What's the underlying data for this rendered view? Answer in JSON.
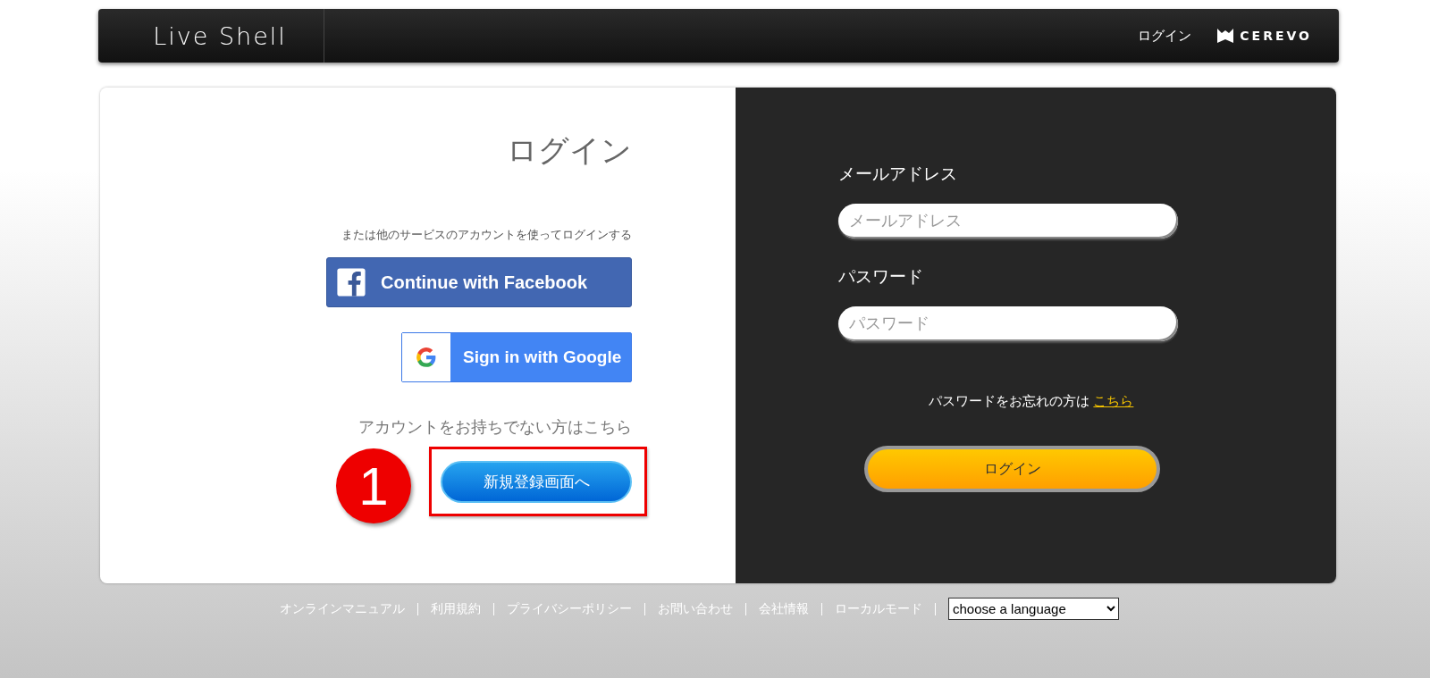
{
  "header": {
    "logo": "Live Shell",
    "nav_login": "ログイン",
    "brand": "CEREVO"
  },
  "login_panel": {
    "title": "ログイン",
    "social_hint": "または他のサービスのアカウントを使ってログインする",
    "social_buttons": [
      {
        "kind": "facebook",
        "label": "Continue with Facebook"
      },
      {
        "kind": "google",
        "label": "Sign in with Google"
      }
    ],
    "signup_hint": "アカウントをお持ちでない方はこちら",
    "signup_button": {
      "label": "新規登録画面へ",
      "highlighted": true,
      "annotation": "1"
    }
  },
  "form": {
    "fields": [
      {
        "label": "メールアドレス",
        "placeholder": "メールアドレス"
      },
      {
        "label": "パスワード",
        "placeholder": "パスワード"
      }
    ],
    "forgot_text": "パスワードをお忘れの方は",
    "forgot_link": "こちら",
    "submit": "ログイン"
  },
  "footer": {
    "links": [
      "オンラインマニュアル",
      "利用規約",
      "プライバシーポリシー",
      "お問い合わせ",
      "会社情報",
      "ローカルモード"
    ],
    "language_select": "choose a language"
  }
}
